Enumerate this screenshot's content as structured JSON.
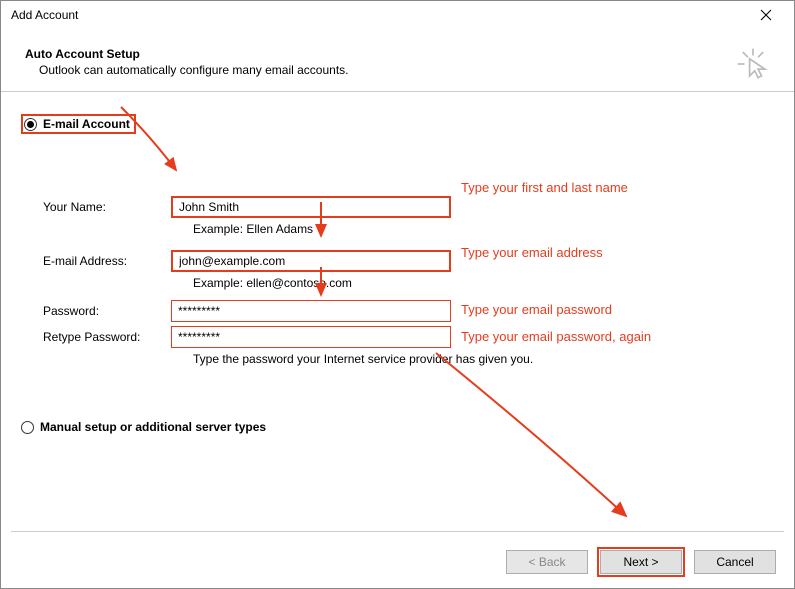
{
  "window": {
    "title": "Add Account"
  },
  "header": {
    "heading": "Auto Account Setup",
    "subheading": "Outlook can automatically configure many email accounts."
  },
  "options": {
    "email_account_label": "E-mail Account",
    "manual_label": "Manual setup or additional server types"
  },
  "form": {
    "your_name": {
      "label": "Your Name:",
      "value": "John Smith",
      "example": "Example: Ellen Adams"
    },
    "email": {
      "label": "E-mail Address:",
      "value": "john@example.com",
      "example": "Example: ellen@contoso.com"
    },
    "password": {
      "label": "Password:",
      "value": "*********"
    },
    "retype": {
      "label": "Retype Password:",
      "value": "*********"
    },
    "note": "Type the password your Internet service provider has given you."
  },
  "annotations": {
    "name": "Type your first and last name",
    "email": "Type your email address",
    "password": "Type your email password",
    "retype": "Type your email password, again"
  },
  "buttons": {
    "back": "< Back",
    "next": "Next >",
    "cancel": "Cancel"
  }
}
